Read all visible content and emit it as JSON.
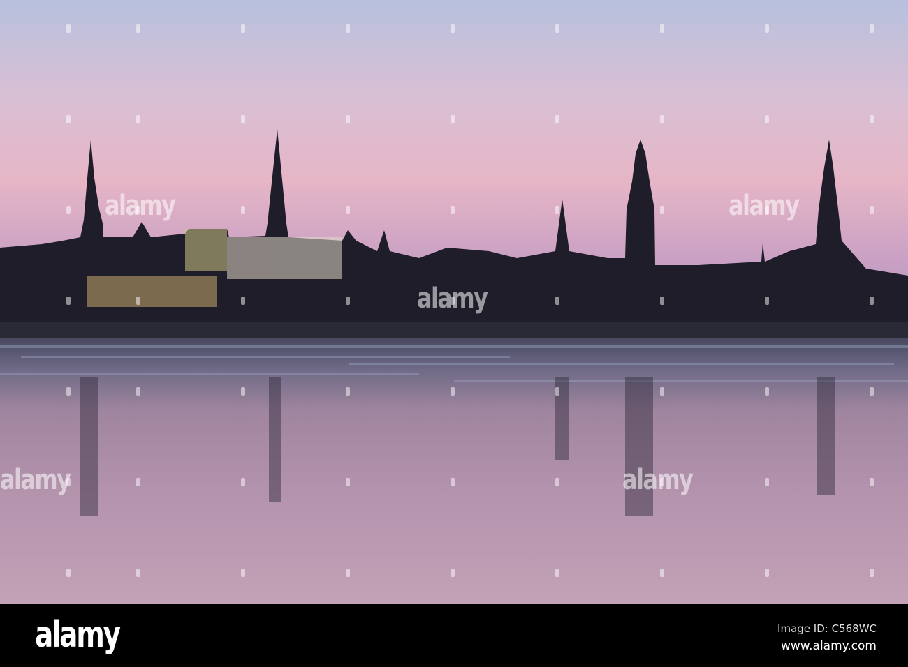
{
  "watermark": {
    "text": "alamy"
  },
  "footer": {
    "logo": "alamy",
    "image_id": "Image ID: C568WC",
    "url": "www.alamy.com"
  }
}
